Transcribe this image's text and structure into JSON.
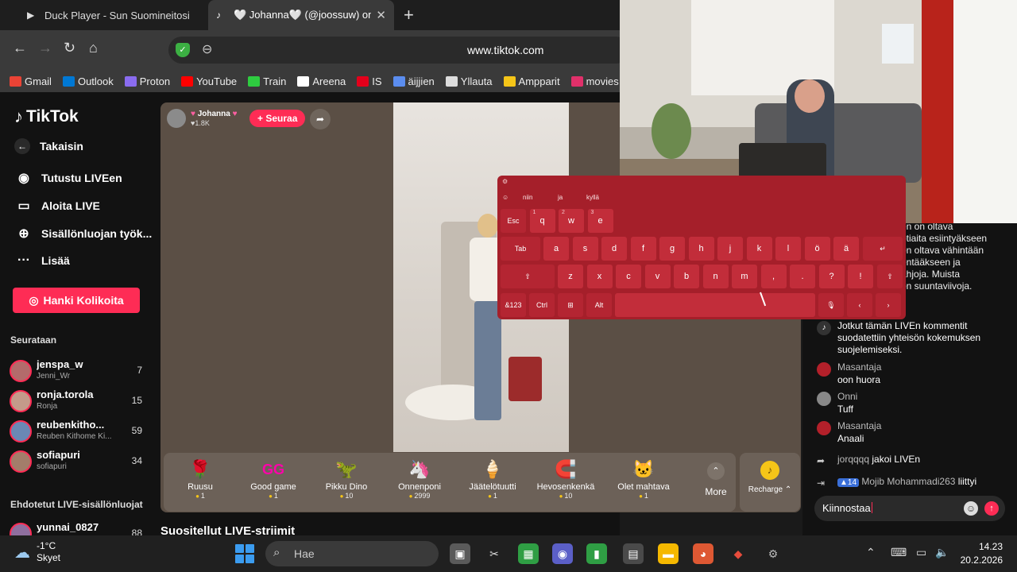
{
  "browser": {
    "tabs": [
      {
        "icon": "▶",
        "title": "Duck Player - Sun Suomineitosi"
      },
      {
        "icon": "♪",
        "title": "🤍 Johanna🤍 (@joossuw) on TikTok"
      }
    ],
    "new_tab": "+",
    "url": "www.tiktok.com",
    "bookmarks": [
      {
        "label": "Gmail",
        "color": "#ea4335"
      },
      {
        "label": "Outlook",
        "color": "#0078d4"
      },
      {
        "label": "Proton",
        "color": "#8a6cf0"
      },
      {
        "label": "YouTube",
        "color": "#ff0000"
      },
      {
        "label": "Train",
        "color": "#2ecc40"
      },
      {
        "label": "Areena",
        "color": "#ffffff"
      },
      {
        "label": "IS",
        "color": "#e3001b"
      },
      {
        "label": "äijjien",
        "color": "#5b8def"
      },
      {
        "label": "Yllauta",
        "color": "#dddddd"
      },
      {
        "label": "Ampparit",
        "color": "#f5c518"
      },
      {
        "label": "movies",
        "color": "#e0306a"
      }
    ]
  },
  "sidebar": {
    "logo": "TikTok",
    "back": "Takaisin",
    "nav": [
      {
        "icon": "◉",
        "label": "Tutustu LIVEen"
      },
      {
        "icon": "▭",
        "label": "Aloita LIVE"
      },
      {
        "icon": "⊕",
        "label": "Sisällönluojan työk..."
      },
      {
        "icon": "···",
        "label": "Lisää"
      }
    ],
    "coins_button": "Hanki Kolikoita",
    "following_title": "Seurataan",
    "following": [
      {
        "name": "jenspa_w",
        "sub": "Jenni_Wr",
        "count": "7",
        "color": "#b36b6b"
      },
      {
        "name": "ronja.torola",
        "sub": "Ronja",
        "count": "15",
        "color": "#c49a8a"
      },
      {
        "name": "reubenkitho...",
        "sub": "Reuben Kithome Ki...",
        "count": "59",
        "color": "#6a88b5"
      },
      {
        "name": "sofiapuri",
        "sub": "sofiapuri",
        "count": "34",
        "color": "#a37d6a"
      }
    ],
    "suggested_title": "Ehdotetut LIVE-sisällönluojat",
    "suggested": [
      {
        "name": "yunnai_0827",
        "count": "88",
        "color": "#8f6f9f"
      }
    ]
  },
  "live": {
    "host_name": "Johanna",
    "likes": "1.8K",
    "follow_button": "+ Seuraa",
    "gifts": [
      {
        "icon": "🌹",
        "name": "Ruusu",
        "price": "1"
      },
      {
        "icon": "GG",
        "name": "Good game",
        "price": "1"
      },
      {
        "icon": "🦖",
        "name": "Pikku Dino",
        "price": "10"
      },
      {
        "icon": "🦄",
        "name": "Onnenponi",
        "price": "2999"
      },
      {
        "icon": "🍦",
        "name": "Jäätelötuutti",
        "price": "1"
      },
      {
        "icon": "🧲",
        "name": "Hevosenkenkä",
        "price": "10"
      },
      {
        "icon": "🐱",
        "name": "Olet mahtava",
        "price": "1"
      }
    ],
    "more": "More",
    "recharge": "Recharge",
    "suggested_streams": "Suositellut LIVE-striimit"
  },
  "chat": {
    "system_rules": [
      "...en on oltava",
      "...otiaita esiintyäkseen",
      "...on oltava vähintään",
      "...entääkseen ja",
      "...ahjoja. Muista",
      "...ön suuntaviivoja."
    ],
    "filter_notice": "Jotkut tämän LIVEn kommentit suodatettiin yhteisön kokemuksen suojelemiseksi.",
    "messages": [
      {
        "user": "Masantaja",
        "text": "oon huora",
        "color": "#b3202a"
      },
      {
        "user": "Onni",
        "text": "Tuff",
        "color": "#888888"
      },
      {
        "user": "Masantaja",
        "text": "Anaali",
        "color": "#b3202a"
      }
    ],
    "share_event": {
      "user": "jorqqqq",
      "text": "jakoi LIVEn"
    },
    "join_event": {
      "badge": "14",
      "user": "Mojib Mohammadi263",
      "text": "liittyi"
    },
    "input_value": "Kiinnostaa"
  },
  "keyboard": {
    "suggestions": [
      "niin",
      "ja",
      "kyllä"
    ],
    "row1": [
      {
        "k": "Esc"
      },
      {
        "k": "q",
        "s": "1"
      },
      {
        "k": "w",
        "s": "2"
      },
      {
        "k": "e",
        "s": "3"
      }
    ],
    "row2": [
      "Tab",
      "a",
      "s",
      "d",
      "f",
      "g",
      "h",
      "j",
      "k",
      "l",
      "ö",
      "ä",
      "↵"
    ],
    "row3": [
      "⇧",
      "z",
      "x",
      "c",
      "v",
      "b",
      "n",
      "m",
      ",",
      ".",
      "?",
      "!",
      "⇧"
    ],
    "row4": [
      "&123",
      "Ctrl",
      "⊞",
      "Alt",
      "",
      "🎙",
      "‹",
      "›"
    ]
  },
  "taskbar": {
    "temp": "-1°C",
    "weather": "Skyet",
    "search_placeholder": "Hae",
    "time": "14.23",
    "date": "20.2.2026"
  }
}
